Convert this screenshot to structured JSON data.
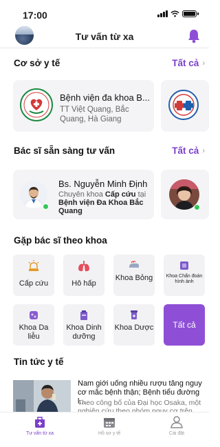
{
  "status_bar": {
    "time": "17:00"
  },
  "header": {
    "title": "Tư vấn từ xa"
  },
  "facilities": {
    "title": "Cơ sở y tế",
    "see_all": "Tất cả",
    "items": [
      {
        "name": "Bệnh viện đa khoa B...",
        "address": "TT Việt Quang, Bắc Quang, Hà Giang"
      }
    ]
  },
  "doctors": {
    "title": "Bác sĩ sẵn sàng tư vấn",
    "see_all": "Tất cả",
    "items": [
      {
        "name": "Bs. Nguyễn Minh Định",
        "spec_prefix": "Chuyên khoa ",
        "specialty": "Cấp cứu",
        "spec_mid": " tại ",
        "hospital": "Bệnh viện Đa Khoa Bắc Quang"
      }
    ]
  },
  "departments": {
    "title": "Gặp bác sĩ theo khoa",
    "items": [
      {
        "label": "Cấp cứu",
        "icon": "siren-icon"
      },
      {
        "label": "Hô hấp",
        "icon": "lungs-icon"
      },
      {
        "label": "Khoa Bỏng",
        "icon": "burn-icon"
      },
      {
        "label": "Khoa Chẩn đoán hình ảnh",
        "icon": "imaging-icon"
      },
      {
        "label": "Khoa Da liễu",
        "icon": "skin-icon"
      },
      {
        "label": "Khoa Dinh dưỡng",
        "icon": "nutrition-icon"
      },
      {
        "label": "Khoa Dược",
        "icon": "pharmacy-icon"
      }
    ],
    "see_all": "Tất cả"
  },
  "news": {
    "title": "Tin tức y tế",
    "items": [
      {
        "title": "Nam giới uống nhiều rượu tăng nguy cơ mắc bệnh thận; Bệnh tiểu đường l...",
        "summary": "Theo công bố của Đại học Osaka, một nghiên cứu theo nhóm nguy cơ trên..."
      }
    ]
  },
  "tabbar": {
    "items": [
      {
        "label": "Tư vấn từ xa",
        "icon": "doctor-bag-icon",
        "active": true
      },
      {
        "label": "Hồ sơ y tế",
        "icon": "calendar-icon",
        "active": false
      },
      {
        "label": "Cài đặt",
        "icon": "person-icon",
        "active": false
      }
    ]
  },
  "colors": {
    "accent": "#8e4fd6",
    "accent_text": "#7b3fc9",
    "online": "#35c759"
  }
}
